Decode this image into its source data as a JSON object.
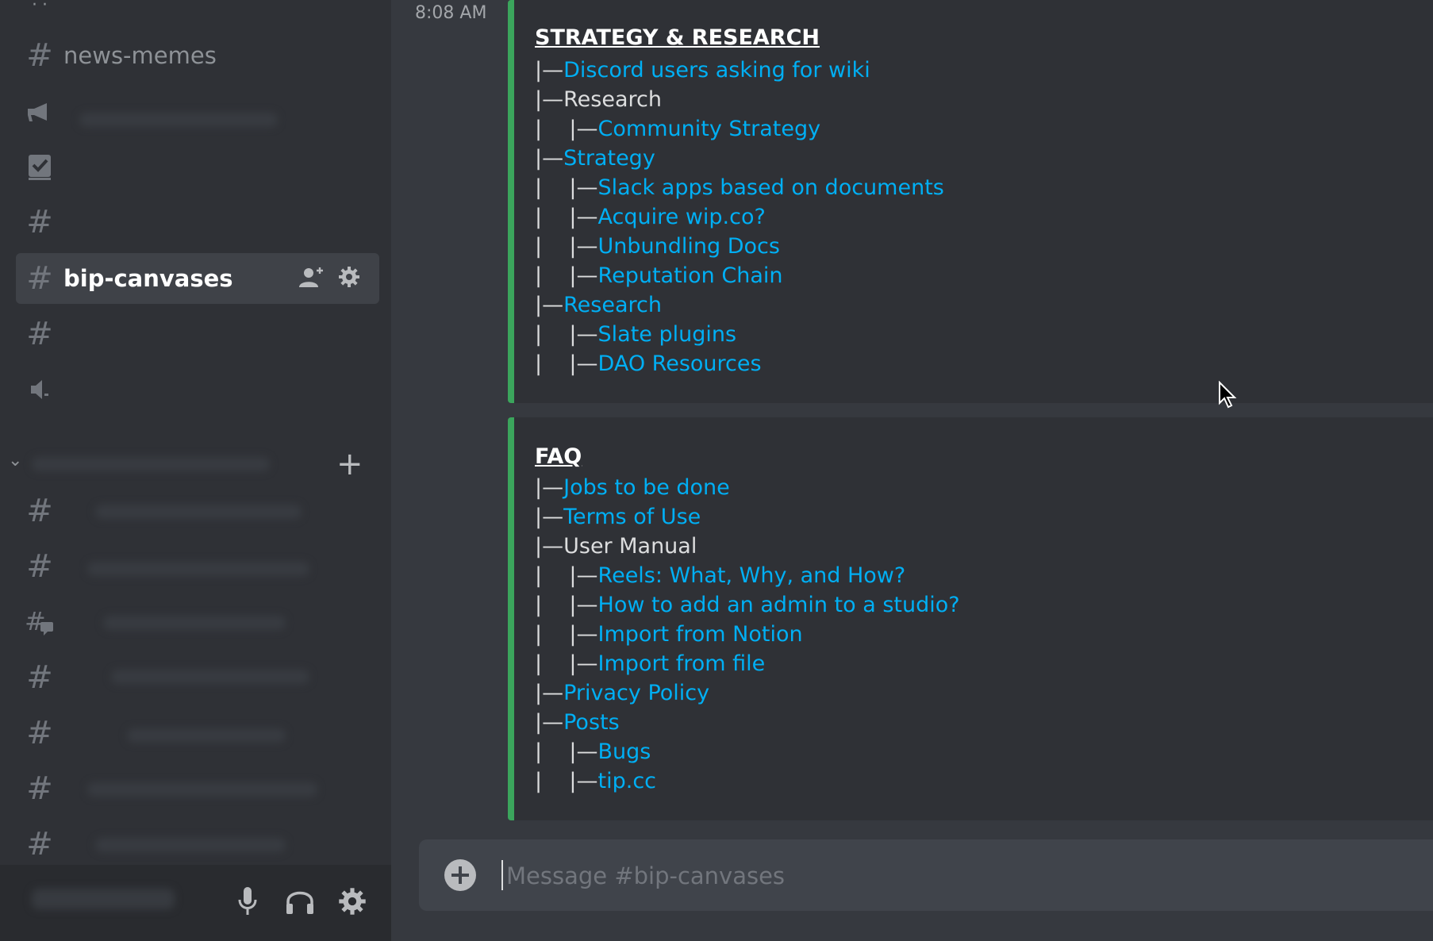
{
  "sidebar": {
    "channels": [
      {
        "name": "news-memes",
        "icon": "hash-icon"
      },
      {
        "name": "",
        "icon": "megaphone-icon"
      },
      {
        "name": "",
        "icon": "checkbox-icon"
      },
      {
        "name": "",
        "icon": "hash-icon"
      },
      {
        "name": "bip-canvases",
        "icon": "hash-icon",
        "active": true
      },
      {
        "name": "",
        "icon": "hash-icon"
      },
      {
        "name": "",
        "icon": "speaker-icon"
      }
    ],
    "category": {
      "add_label": "+"
    },
    "channels2": [
      {
        "name": "",
        "icon": "hash-icon"
      },
      {
        "name": "",
        "icon": "hash-icon"
      },
      {
        "name": "",
        "icon": "hash-chat-icon"
      },
      {
        "name": "",
        "icon": "hash-icon"
      },
      {
        "name": "",
        "icon": "hash-icon"
      },
      {
        "name": "",
        "icon": "hash-icon"
      },
      {
        "name": "",
        "icon": "hash-icon"
      }
    ]
  },
  "main": {
    "timestamp": "8:08 AM",
    "embeds": [
      {
        "title": "STRATEGY & RESEARCH",
        "lines": [
          {
            "prefix": "|—",
            "text": "Discord users asking for wiki",
            "link": true
          },
          {
            "prefix": "|—",
            "text": "Research",
            "link": false
          },
          {
            "prefix": "|    |—",
            "text": "Community Strategy",
            "link": true
          },
          {
            "prefix": "|—",
            "text": "Strategy",
            "link": true
          },
          {
            "prefix": "|    |—",
            "text": "Slack apps based on documents",
            "link": true
          },
          {
            "prefix": "|    |—",
            "text": "Acquire wip.co?",
            "link": true
          },
          {
            "prefix": "|    |—",
            "text": "Unbundling Docs",
            "link": true
          },
          {
            "prefix": "|    |—",
            "text": "Reputation Chain",
            "link": true
          },
          {
            "prefix": "|—",
            "text": "Research",
            "link": true
          },
          {
            "prefix": "|    |—",
            "text": "Slate plugins",
            "link": true
          },
          {
            "prefix": "|    |—",
            "text": "DAO Resources",
            "link": true
          }
        ]
      },
      {
        "title": "FAQ",
        "lines": [
          {
            "prefix": "|—",
            "text": "Jobs to be done",
            "link": true
          },
          {
            "prefix": "|—",
            "text": "Terms of Use",
            "link": true
          },
          {
            "prefix": "|—",
            "text": "User Manual",
            "link": false
          },
          {
            "prefix": "|    |—",
            "text": "Reels: What, Why, and How?",
            "link": true
          },
          {
            "prefix": "|    |—",
            "text": "How to add an admin to a studio?",
            "link": true
          },
          {
            "prefix": "|    |—",
            "text": "Import from Notion",
            "link": true
          },
          {
            "prefix": "|    |—",
            "text": "Import from file",
            "link": true
          },
          {
            "prefix": "|—",
            "text": "Privacy Policy",
            "link": true
          },
          {
            "prefix": "|—",
            "text": "Posts",
            "link": true
          },
          {
            "prefix": "|    |—",
            "text": "Bugs",
            "link": true
          },
          {
            "prefix": "|    |—",
            "text": "tip.cc",
            "link": true
          }
        ]
      }
    ],
    "composer": {
      "placeholder": "Message #bip-canvases",
      "value": ""
    }
  },
  "colors": {
    "link": "#00aff4",
    "embed_border": "#3ba55c",
    "background": "#36393f",
    "sidebar": "#2f3136"
  }
}
